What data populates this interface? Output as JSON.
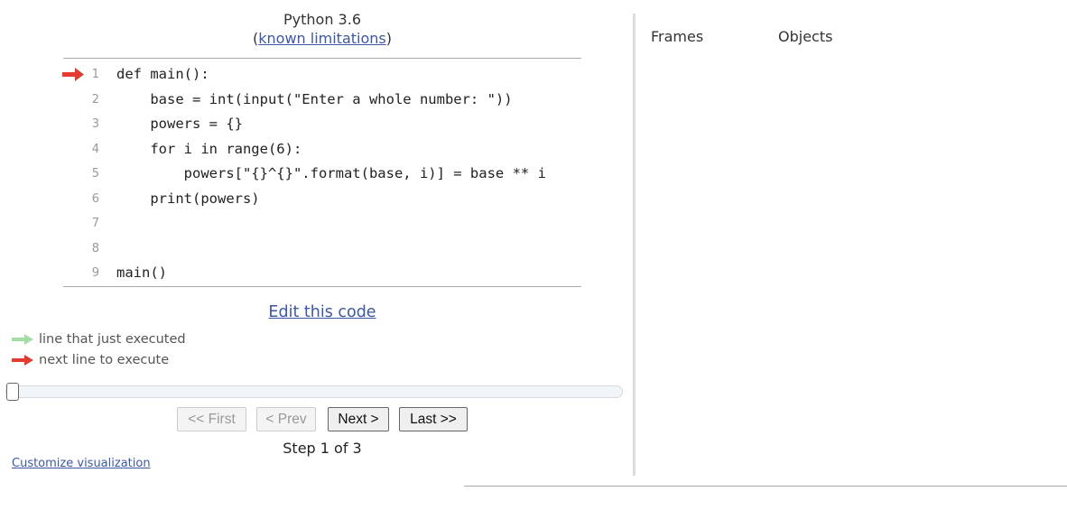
{
  "header": {
    "language": "Python 3.6",
    "limitations_open": "(",
    "limitations_link": "known limitations",
    "limitations_close": ")"
  },
  "code": {
    "lines": [
      {
        "num": "1",
        "text": "def main():",
        "arrow": "next"
      },
      {
        "num": "2",
        "text": "    base = int(input(\"Enter a whole number: \"))",
        "arrow": ""
      },
      {
        "num": "3",
        "text": "    powers = {}",
        "arrow": ""
      },
      {
        "num": "4",
        "text": "    for i in range(6):",
        "arrow": ""
      },
      {
        "num": "5",
        "text": "        powers[\"{}^{}\".format(base, i)] = base ** i",
        "arrow": ""
      },
      {
        "num": "6",
        "text": "    print(powers)",
        "arrow": ""
      },
      {
        "num": "7",
        "text": "",
        "arrow": ""
      },
      {
        "num": "8",
        "text": "",
        "arrow": ""
      },
      {
        "num": "9",
        "text": "main()",
        "arrow": ""
      }
    ]
  },
  "edit_link": "Edit this code",
  "legend": {
    "executed_label": "line that just executed",
    "next_label": "next line to execute",
    "executed_color": "#a4dea4",
    "next_color": "#e53a2f"
  },
  "slider": {
    "position": 0
  },
  "navigation": {
    "first": "<< First",
    "prev": "< Prev",
    "next": "Next >",
    "last": "Last >>"
  },
  "step": {
    "label": "Step 1 of 3",
    "current": 1,
    "total": 3
  },
  "customize_link": "Customize visualization",
  "visualization": {
    "frames_label": "Frames",
    "objects_label": "Objects"
  }
}
